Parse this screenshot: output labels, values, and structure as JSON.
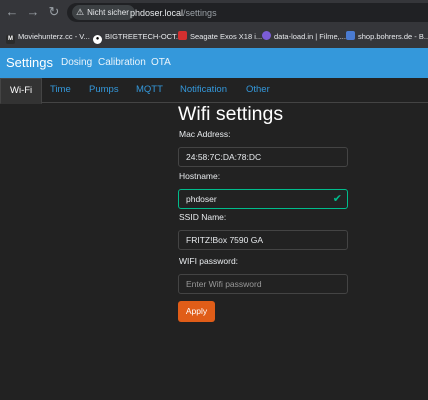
{
  "browser": {
    "nav_icons": [
      "back-arrow-icon",
      "forward-arrow-icon",
      "reload-icon"
    ],
    "security_label": "Nicht sicher",
    "url_host": "phdoser.local",
    "url_path": "/settings",
    "bookmarks": [
      {
        "label": "Moviehunterz.cc - V...",
        "icon": "moviehunterz-icon",
        "color": "#2b2b2b"
      },
      {
        "label": "BIGTREETECH-OCT...",
        "icon": "github-icon",
        "color": "#ffffff"
      },
      {
        "label": "Seagate Exos X18 i...",
        "icon": "seagate-icon",
        "color": "#d32f2f"
      },
      {
        "label": "data-load.in | Filme,...",
        "icon": "data-load-icon",
        "color": "#7b5cd6"
      },
      {
        "label": "shop.bohrers.de - B...",
        "icon": "shop-bohrers-icon",
        "color": "#4a7bd1"
      }
    ]
  },
  "navbar": {
    "brand": "Settings",
    "links": [
      "Dosing",
      "Calibration",
      "OTA"
    ]
  },
  "tabs": [
    "Wi-Fi",
    "Time",
    "Pumps",
    "MQTT",
    "Notification",
    "Other"
  ],
  "form": {
    "heading": "Wifi settings",
    "mac_label": "Mac Address:",
    "mac_value": "24:58:7C:DA:78:DC",
    "hostname_label": "Hostname:",
    "hostname_value": "phdoser",
    "ssid_label": "SSID Name:",
    "ssid_value": "FRITZ!Box 7590 GA",
    "password_label": "WIFI password:",
    "password_placeholder": "Enter Wifi password",
    "apply_label": "Apply"
  },
  "colors": {
    "navbar": "#3498db",
    "apply": "#e05d18",
    "valid": "#00bc8c",
    "background": "#222222"
  }
}
